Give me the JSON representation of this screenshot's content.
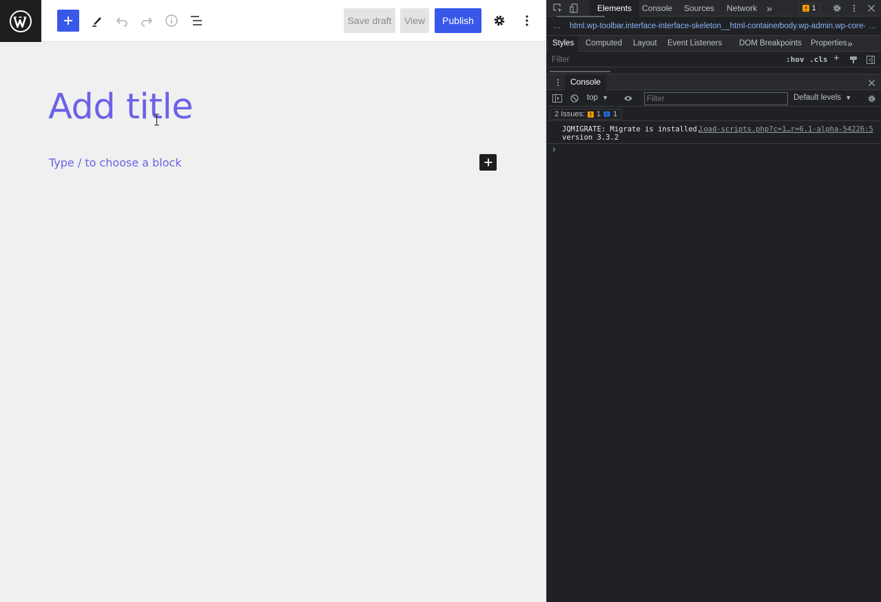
{
  "editor": {
    "toolbar": {
      "add_block_icon": "plus-icon",
      "tools_icon": "pencil-icon",
      "undo_icon": "undo-icon",
      "redo_icon": "redo-icon",
      "details_icon": "info-icon",
      "list_view_icon": "list-view-icon",
      "save_draft_label": "Save draft",
      "view_label": "View",
      "publish_label": "Publish",
      "settings_icon": "gear-icon",
      "more_icon": "vertical-dots-icon"
    },
    "title_placeholder": "Add title",
    "block_placeholder": "Type / to choose a block",
    "colors": {
      "accent": "#3858e9",
      "placeholder": "#6b62e8"
    }
  },
  "devtools": {
    "tabs": [
      "Elements",
      "Console",
      "Sources",
      "Network"
    ],
    "active_tab": "Elements",
    "issue_badge_count": "1",
    "breadcrumbs": {
      "html": "html.wp-toolbar.interface-interface-skeleton__html-container",
      "body": "body.wp-admin.wp-core-"
    },
    "subtabs": [
      "Styles",
      "Computed",
      "Layout",
      "Event Listeners",
      "DOM Breakpoints",
      "Properties"
    ],
    "styles_filter_placeholder": "Filter",
    "hov_label": ":hov",
    "cls_label": ".cls",
    "drawer_tab": "Console",
    "console": {
      "context": "top",
      "filter_placeholder": "Filter",
      "levels": "Default levels",
      "issues_label": "2 Issues:",
      "issues_warning_count": "1",
      "issues_info_count": "1",
      "log_line_1": "JQMIGRATE: Migrate is installed,",
      "log_line_2": "version 3.3.2",
      "log_source": "load-scripts.php?c=1…r=6.1-alpha-54226:5",
      "prompt": "›"
    }
  }
}
